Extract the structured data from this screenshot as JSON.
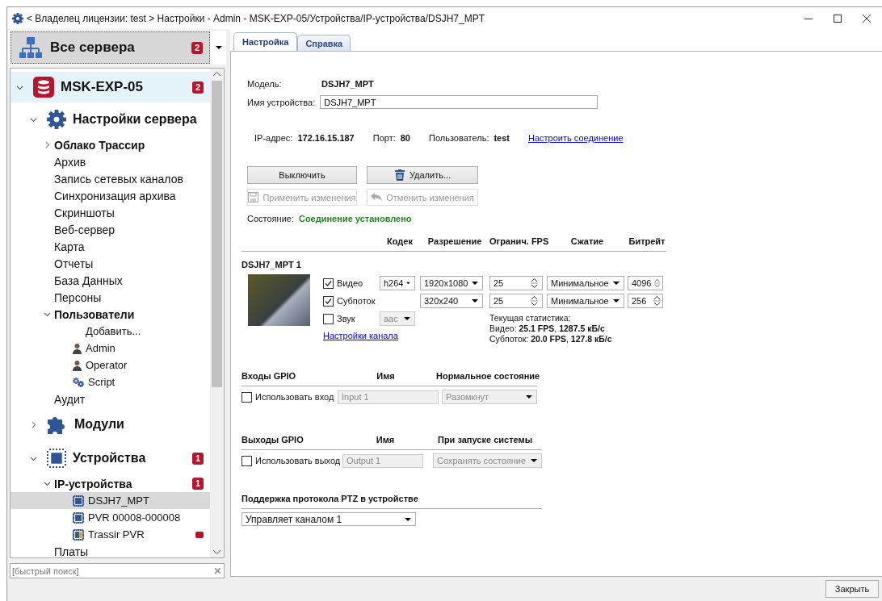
{
  "window": {
    "title": "< Владелец лицензии: test > Настройки - Admin - MSK-EXP-05/Устройства/IP-устройства/DSJH7_MPT"
  },
  "sidebar": {
    "server_selector": {
      "label": "Все сервера",
      "badge": "2"
    },
    "tree": [
      {
        "label": "MSK-EXP-05",
        "kind": "server",
        "badge": "2",
        "expanded": true,
        "selected": false,
        "children": [
          {
            "label": "Настройки сервера",
            "kind": "settings",
            "expanded": true,
            "selected": false,
            "children": [
              {
                "label": "Облако Трассир",
                "kind": "group",
                "expanded": false,
                "selected": false
              },
              {
                "label": "Архив",
                "kind": "item",
                "selected": false
              },
              {
                "label": "Запись сетевых каналов",
                "kind": "item",
                "selected": false
              },
              {
                "label": "Синхронизация архива",
                "kind": "item",
                "selected": false
              },
              {
                "label": "Скриншоты",
                "kind": "item",
                "selected": false
              },
              {
                "label": "Веб-сервер",
                "kind": "item",
                "selected": false
              },
              {
                "label": "Карта",
                "kind": "item",
                "selected": false
              },
              {
                "label": "Отчеты",
                "kind": "item",
                "selected": false
              },
              {
                "label": "База Данных",
                "kind": "item",
                "selected": false
              },
              {
                "label": "Персоны",
                "kind": "item",
                "selected": false
              },
              {
                "label": "Пользователи",
                "kind": "group",
                "expanded": true,
                "selected": false,
                "children": [
                  {
                    "label": "Добавить...",
                    "kind": "action",
                    "selected": false
                  },
                  {
                    "label": "Admin",
                    "kind": "user",
                    "selected": false
                  },
                  {
                    "label": "Operator",
                    "kind": "user",
                    "selected": false
                  },
                  {
                    "label": "Script",
                    "kind": "script",
                    "selected": false
                  }
                ]
              },
              {
                "label": "Аудит",
                "kind": "item",
                "selected": false
              }
            ]
          },
          {
            "label": "Модули",
            "kind": "modules",
            "expanded": false,
            "selected": false
          },
          {
            "label": "Устройства",
            "kind": "devices",
            "badge": "1",
            "expanded": true,
            "selected": false,
            "children": [
              {
                "label": "IP-устройства",
                "kind": "group",
                "badge": "1",
                "expanded": true,
                "selected": false,
                "children": [
                  {
                    "label": "DSJH7_MPT",
                    "kind": "device",
                    "alarm": false,
                    "selected": true
                  },
                  {
                    "label": "PVR 00008-000008",
                    "kind": "device",
                    "alarm": false,
                    "selected": false
                  },
                  {
                    "label": "Trassir PVR",
                    "kind": "device",
                    "alarm": true,
                    "selected": false
                  }
                ]
              },
              {
                "label": "Платы",
                "kind": "item",
                "selected": false
              }
            ]
          }
        ]
      }
    ],
    "search": {
      "placeholder": "[быстрый поиск]"
    }
  },
  "tabs": [
    {
      "label": "Настройка",
      "selected": true
    },
    {
      "label": "Справка",
      "selected": false
    }
  ],
  "device": {
    "model_label": "Модель:",
    "model": "DSJH7_MPT",
    "name_label": "Имя устройства:",
    "name": "DSJH7_MPT",
    "connection": [
      {
        "label": "IP-адрес:",
        "value": "172.16.15.187"
      },
      {
        "label": "Порт:",
        "value": "80"
      },
      {
        "label": "Пользователь:",
        "value": "test"
      }
    ],
    "connection_link": "Настроить соединение",
    "buttons": [
      {
        "label": "Выключить",
        "kind": "plain",
        "disabled": false
      },
      {
        "label": "Удалить...",
        "kind": "delete",
        "disabled": false
      },
      {
        "label": "Применить изменения",
        "kind": "save",
        "disabled": true
      },
      {
        "label": "Отменить изменения",
        "kind": "undo",
        "disabled": true
      }
    ],
    "status_label": "Состояние:",
    "status": "Соединение установлено"
  },
  "channel": {
    "columns": [
      "Кодек",
      "Разрешение",
      "Огранич. FPS",
      "Сжатие",
      "Битрейт"
    ],
    "title": "DSJH7_MPT 1",
    "streams": [
      {
        "label": "Видео",
        "checked": true,
        "disabled": false,
        "codec": "h264",
        "resolution": "1920x1080",
        "fps": "25",
        "compression": "Минимальное",
        "bitrate": "4096"
      },
      {
        "label": "Субпоток",
        "checked": true,
        "disabled": false,
        "resolution": "320x240",
        "fps": "25",
        "compression": "Минимальное",
        "bitrate": "256"
      },
      {
        "label": "Звук",
        "checked": false,
        "disabled": true,
        "codec": "aac"
      }
    ],
    "settings_link": "Настройки канала",
    "stats": [
      "Текущая статистика:",
      "Видео: **25.1 FPS**, **1287.5 кБ/с**",
      "Субпоток: **20.0 FPS**, **127.8 кБ/с**"
    ]
  },
  "gpio": [
    {
      "columns": [
        "Входы GPIO",
        "Имя",
        "Нормальное состояние"
      ],
      "label": "Использовать вход",
      "checked": false,
      "name": "Input 1",
      "state": "Разомкнут"
    },
    {
      "columns": [
        "Выходы GPIO",
        "Имя",
        "При запуске системы"
      ],
      "label": "Использовать выход",
      "checked": false,
      "name": "Output 1",
      "state": "Сохранять состояние"
    }
  ],
  "ptz": {
    "title": "Поддержка протокола PTZ в устройстве",
    "value": "Управляет каналом 1"
  },
  "footer": {
    "close": "Закрыть"
  }
}
